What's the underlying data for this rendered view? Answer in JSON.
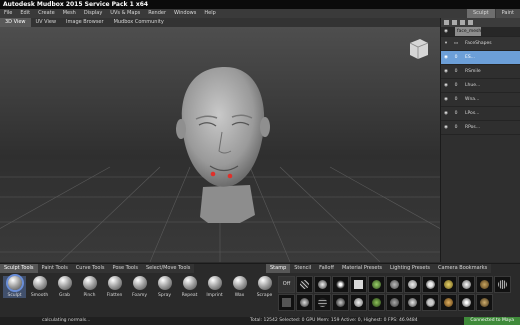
{
  "window": {
    "title": "Autodesk Mudbox 2015 Service Pack 1 x64"
  },
  "menu": {
    "items": [
      "File",
      "Edit",
      "Create",
      "Mesh",
      "Display",
      "UVs & Maps",
      "Render",
      "Windows",
      "Help"
    ],
    "right": [
      "Sculpt",
      "Paint"
    ]
  },
  "view_tabs": [
    "3D View",
    "UV View",
    "Image Browser",
    "Mudbox Community"
  ],
  "layers": {
    "root": "face_mesh",
    "group": "FaceShapes",
    "rows": [
      {
        "visibility": "0",
        "name": "ES..."
      },
      {
        "visibility": "0",
        "name": "RSmile"
      },
      {
        "visibility": "0",
        "name": "Lhue..."
      },
      {
        "visibility": "0",
        "name": "Wna..."
      },
      {
        "visibility": "0",
        "name": "LPos..."
      },
      {
        "visibility": "0",
        "name": "RPos..."
      }
    ]
  },
  "tool_tray": {
    "tabs": [
      "Sculpt Tools",
      "Paint Tools",
      "Curve Tools",
      "Pose Tools",
      "Select/Move Tools"
    ],
    "tools": [
      "Sculpt",
      "Smooth",
      "Grab",
      "Pinch",
      "Flatten",
      "Foamy",
      "Spray",
      "Repeat",
      "Imprint",
      "Wax",
      "Scrape"
    ]
  },
  "stamp_tray": {
    "tabs": [
      "Stamp",
      "Stencil",
      "Falloff",
      "Material Presets",
      "Lighting Presets",
      "Camera Bookmarks"
    ],
    "off_label": "Off"
  },
  "status": {
    "message": "calculating normals...",
    "stats": "Total: 12542  Selected: 0  GPU Mem: 159  Active: 0, Highest: 0  FPS: 46.9484",
    "connection": "Connected to Maya"
  },
  "colors": {
    "accent": "#6c9fd8",
    "connected": "#3f8a3a",
    "selection_marks": "#e0302a"
  }
}
